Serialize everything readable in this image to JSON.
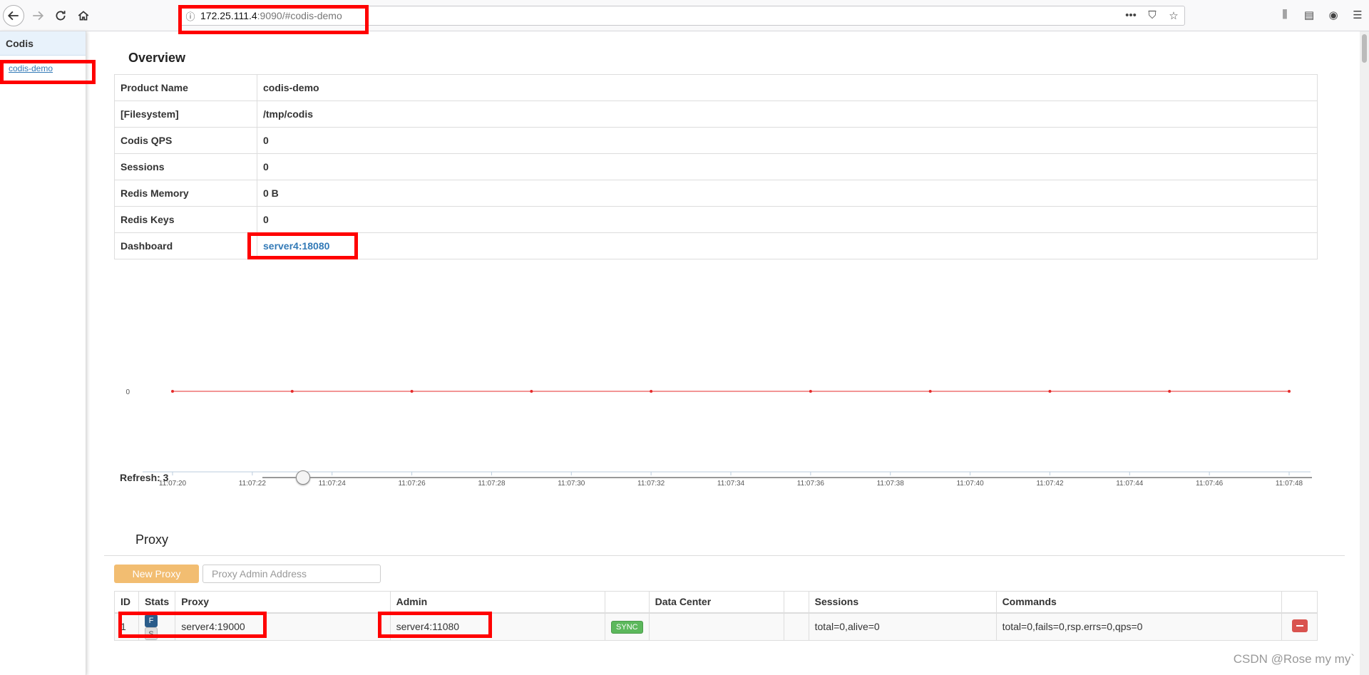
{
  "browser": {
    "url_host": "172.25.111.4",
    "url_rest": ":9090/#codis-demo"
  },
  "sidebar": {
    "header": "Codis",
    "link": "codis-demo"
  },
  "overview": {
    "title": "Overview",
    "rows": [
      {
        "key": "Product Name",
        "value": "codis-demo"
      },
      {
        "key": "[Filesystem]",
        "value": "/tmp/codis"
      },
      {
        "key": "Codis QPS",
        "value": "0"
      },
      {
        "key": "Sessions",
        "value": "0"
      },
      {
        "key": "Redis Memory",
        "value": "0 B"
      },
      {
        "key": "Redis Keys",
        "value": "0"
      }
    ],
    "dashboard_key": "Dashboard",
    "dashboard_value": "server4:18080"
  },
  "chart_data": {
    "type": "line",
    "x_ticks": [
      "11:07:20",
      "11:07:22",
      "11:07:24",
      "11:07:26",
      "11:07:28",
      "11:07:30",
      "11:07:32",
      "11:07:34",
      "11:07:36",
      "11:07:38",
      "11:07:40",
      "11:07:42",
      "11:07:44",
      "11:07:46",
      "11:07:48"
    ],
    "y_ticks": [
      "0"
    ],
    "points_x": [
      "11:07:20",
      "11:07:23",
      "11:07:26",
      "11:07:29",
      "11:07:32",
      "11:07:36",
      "11:07:39",
      "11:07:42",
      "11:07:45",
      "11:07:48"
    ],
    "points_y": [
      0,
      0,
      0,
      0,
      0,
      0,
      0,
      0,
      0,
      0
    ],
    "line_color": "#e52b2b"
  },
  "refresh": {
    "label": "Refresh: 3",
    "value": 3
  },
  "proxy": {
    "title": "Proxy",
    "new_button": "New Proxy",
    "input_placeholder": "Proxy Admin Address",
    "headers": [
      "ID",
      "Stats",
      "Proxy",
      "Admin",
      "",
      "Data Center",
      "",
      "Sessions",
      "Commands",
      ""
    ],
    "row": {
      "id": "1",
      "stat_f": "F",
      "stat_s": "S",
      "proxy": "server4:19000",
      "admin": "server4:11080",
      "sync": "SYNC",
      "data_center": "",
      "sessions": "total=0,alive=0",
      "commands": "total=0,fails=0,rsp.errs=0,qps=0"
    }
  },
  "watermark": "CSDN @Rose my my`"
}
